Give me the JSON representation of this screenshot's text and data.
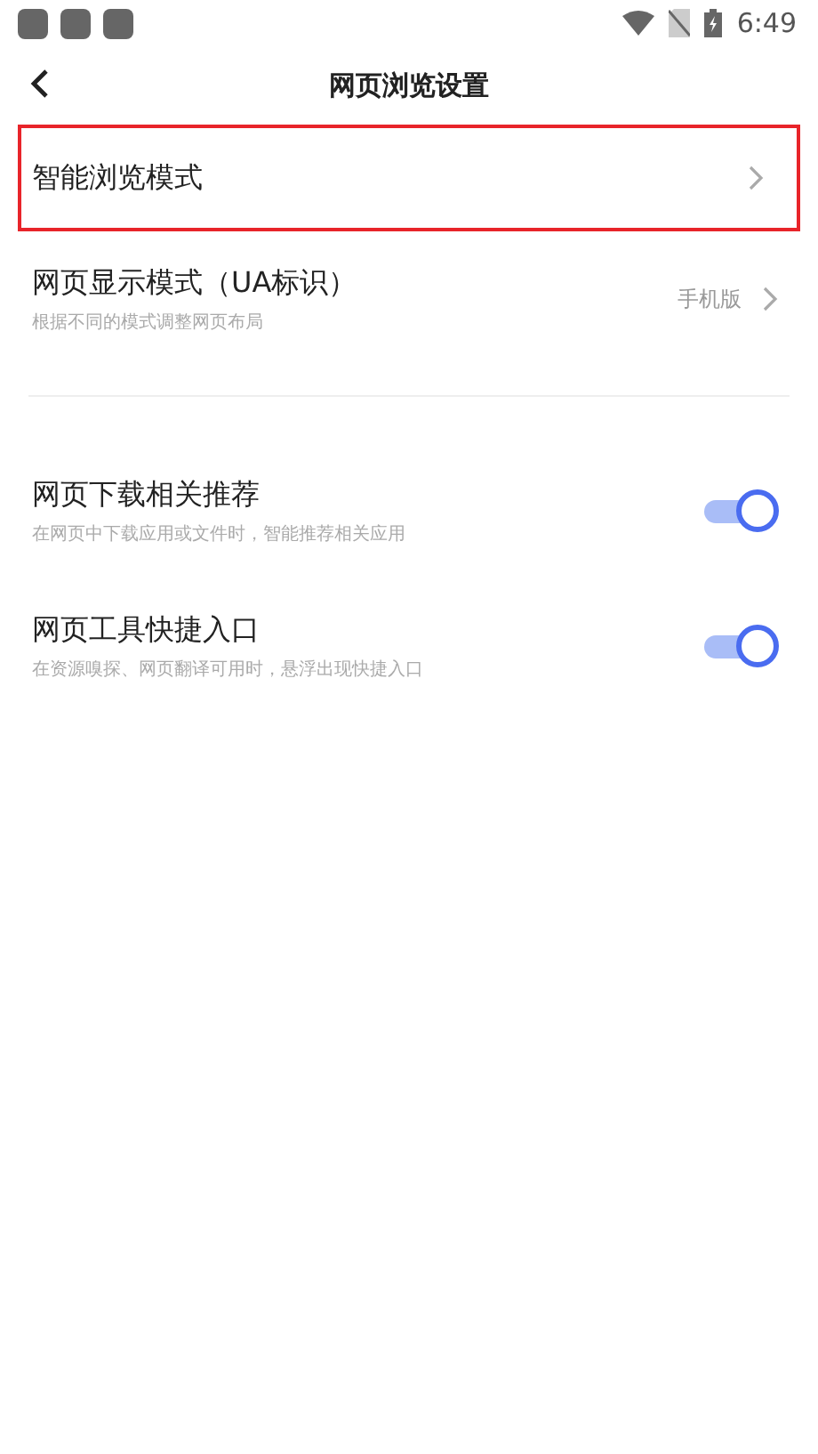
{
  "status_bar": {
    "time": "6:49"
  },
  "header": {
    "title": "网页浏览设置"
  },
  "groups": [
    {
      "rows": [
        {
          "kind": "link",
          "title": "智能浏览模式",
          "highlighted": true
        },
        {
          "kind": "link",
          "title": "网页显示模式（UA标识）",
          "subtitle": "根据不同的模式调整网页布局",
          "value": "手机版",
          "highlighted": false
        }
      ]
    },
    {
      "rows": [
        {
          "kind": "toggle",
          "title": "网页下载相关推荐",
          "subtitle": "在网页中下载应用或文件时，智能推荐相关应用",
          "on": true,
          "highlighted": false
        },
        {
          "kind": "toggle",
          "title": "网页工具快捷入口",
          "subtitle": "在资源嗅探、网页翻译可用时，悬浮出现快捷入口",
          "on": true,
          "highlighted": false
        }
      ]
    }
  ]
}
